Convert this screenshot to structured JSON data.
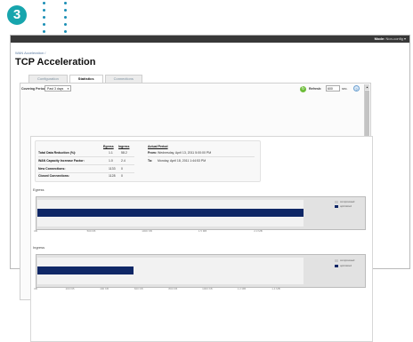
{
  "step_badge": "3",
  "colors": {
    "badge": "#17a5ad",
    "dots": "#1b8fb5",
    "bar": "#0f2766",
    "refresh": "#6ebd3a"
  },
  "topbar": {
    "mode_label": "Mode:",
    "mode_value": "Non-config ▾"
  },
  "breadcrumb": "WAN Acceleration /",
  "page_title": "TCP Acceleration",
  "tabs": [
    {
      "label": "Configuration",
      "active": false
    },
    {
      "label": "Statistics",
      "active": true
    },
    {
      "label": "Connections",
      "active": false
    }
  ],
  "covering_period": {
    "label": "Covering Period:",
    "value": "Past 3 days"
  },
  "refresh": {
    "label": "Refresh:",
    "value": "600",
    "unit": "sec."
  },
  "stats": {
    "headers": {
      "egress": "Egress",
      "ingress": "Ingress",
      "actual_period": "Actual Period"
    },
    "rows": [
      {
        "label": "Total Data Reduction (%):",
        "egress": "1.1",
        "ingress": "58.2"
      },
      {
        "label": "WAN Capacity Increase Factor:",
        "egress": "1.0",
        "ingress": "2.4"
      },
      {
        "label": "New Connections:",
        "egress": "1133",
        "ingress": "0"
      },
      {
        "label": "Closed Connections:",
        "egress": "1128",
        "ingress": "0"
      }
    ],
    "period": {
      "from_label": "From:",
      "from_value": "Wednesday, April 13, 2011 5:00:00 PM",
      "to_label": "To:",
      "to_value": "Monday, April 18, 2011 1:44:53 PM"
    }
  },
  "chart_data": [
    {
      "type": "bar",
      "title": "Egress",
      "series": [
        {
          "name": "optimized",
          "values": [
            1.0
          ]
        }
      ],
      "legend": [
        "compressed",
        "optimized"
      ],
      "tick_labels": [
        "0B",
        "500 KB",
        "1000 KB",
        "1.5 MB",
        "2.0 MB"
      ],
      "xlim_kb": [
        0,
        2300
      ],
      "legend_placement": "right"
    },
    {
      "type": "bar",
      "title": "Ingress",
      "series": [
        {
          "name": "optimized",
          "values": [
            0.36
          ]
        }
      ],
      "legend": [
        "compressed",
        "optimized"
      ],
      "tick_labels": [
        "0B",
        "200 KB",
        "400 KB",
        "600 KB",
        "800 KB",
        "1000 KB",
        "1.2 MB",
        "1.4 MB"
      ],
      "xlim_kb": [
        0,
        1500
      ],
      "legend_placement": "right"
    }
  ]
}
